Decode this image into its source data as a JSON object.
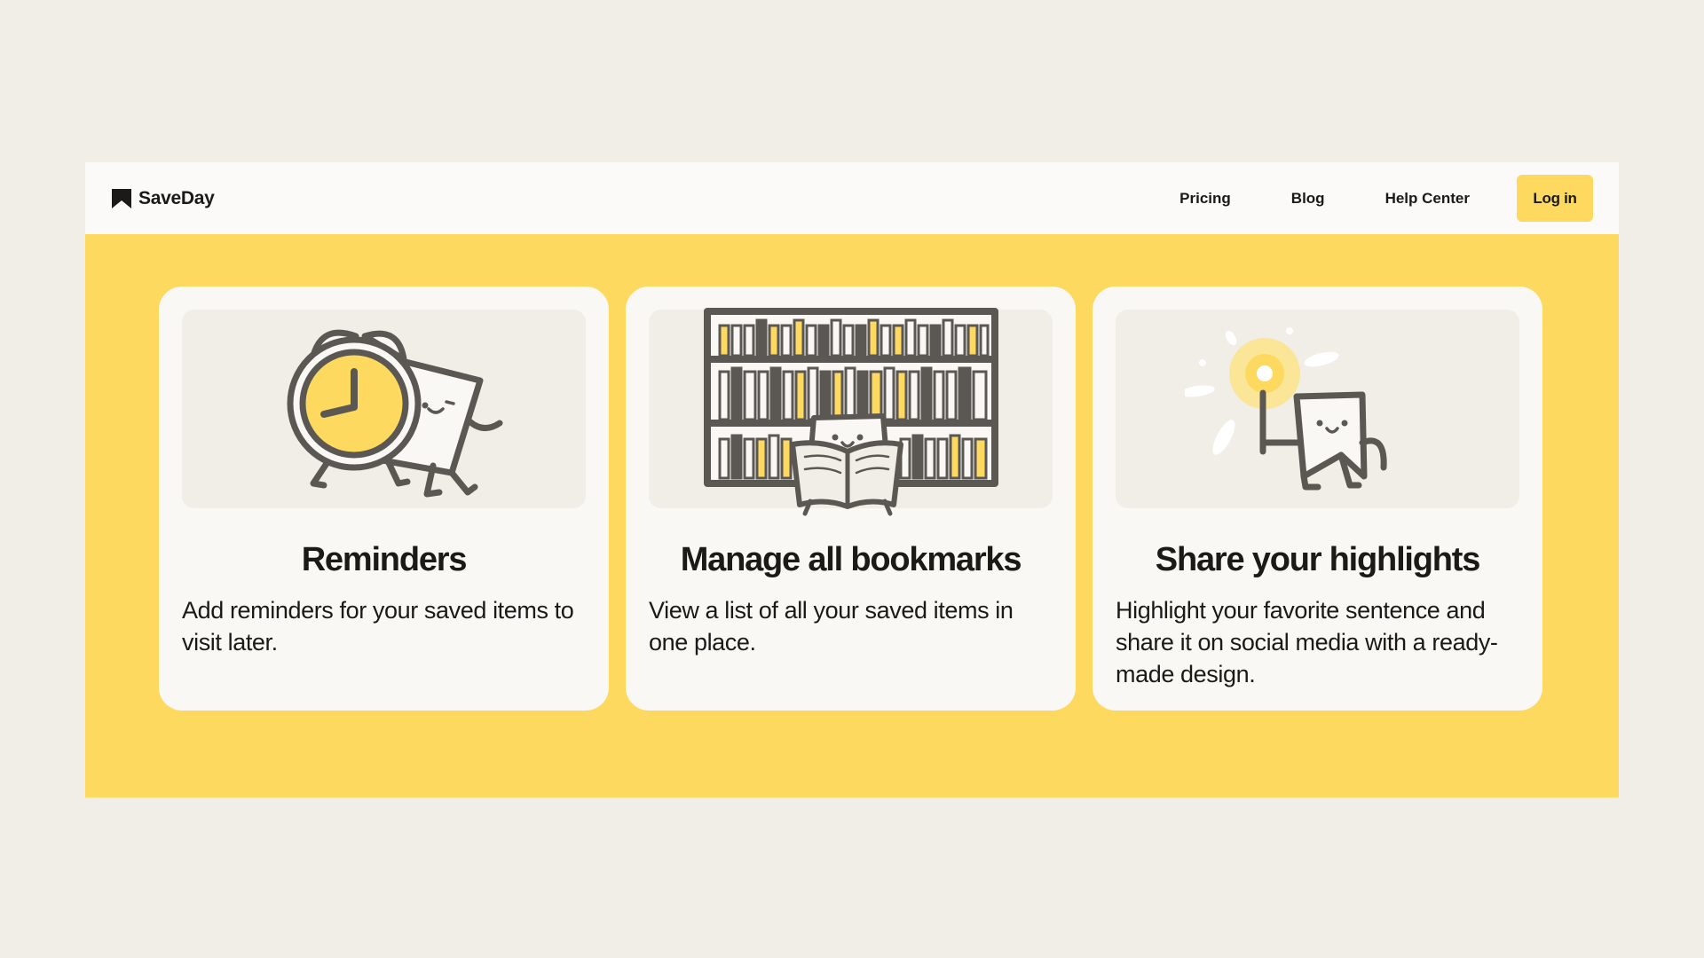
{
  "brand": {
    "name": "SaveDay",
    "logo_icon": "bookmark-icon"
  },
  "nav": {
    "links": [
      {
        "label": "Pricing"
      },
      {
        "label": "Blog"
      },
      {
        "label": "Help Center"
      }
    ],
    "login_label": "Log in"
  },
  "features": [
    {
      "title": "Reminders",
      "description": "Add reminders for your saved items to visit later.",
      "illustration": "alarm-clock-icon"
    },
    {
      "title": "Manage all bookmarks",
      "description": "View a list of all your saved items in one place.",
      "illustration": "bookshelf-icon"
    },
    {
      "title": "Share your highlights",
      "description": "Highlight your favorite sentence and share it on social media with a ready-made design.",
      "illustration": "highlight-torch-icon"
    }
  ],
  "colors": {
    "accent": "#fdd960",
    "page_background": "#f1ede7",
    "card_background": "#f9f8f5",
    "ink": "#1c1a17",
    "illustration_stroke": "#5b5853"
  }
}
